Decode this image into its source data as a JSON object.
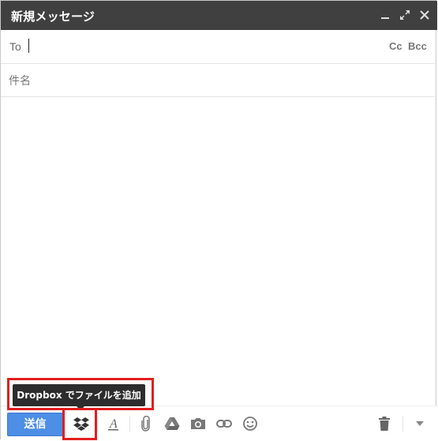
{
  "window": {
    "title": "新規メッセージ",
    "controls": [
      "minimize-icon",
      "expand-icon",
      "close-icon"
    ]
  },
  "recipients": {
    "to_label": "To",
    "cc_label": "Cc",
    "bcc_label": "Bcc"
  },
  "subject": {
    "placeholder": "件名",
    "value": ""
  },
  "body": {
    "value": ""
  },
  "toolbar": {
    "send_label": "送信",
    "icons": [
      "dropbox-icon",
      "formatting-icon",
      "attach-icon",
      "drive-icon",
      "photo-icon",
      "link-icon",
      "emoji-icon",
      "trash-icon",
      "more-options-icon"
    ]
  },
  "tooltip": {
    "text": "Dropbox でファイルを追加"
  },
  "colors": {
    "titlebar": "#404040",
    "send_button": "#4d8ee6",
    "highlight": "#e21e1e",
    "tooltip_bg": "#2d2d2d"
  }
}
